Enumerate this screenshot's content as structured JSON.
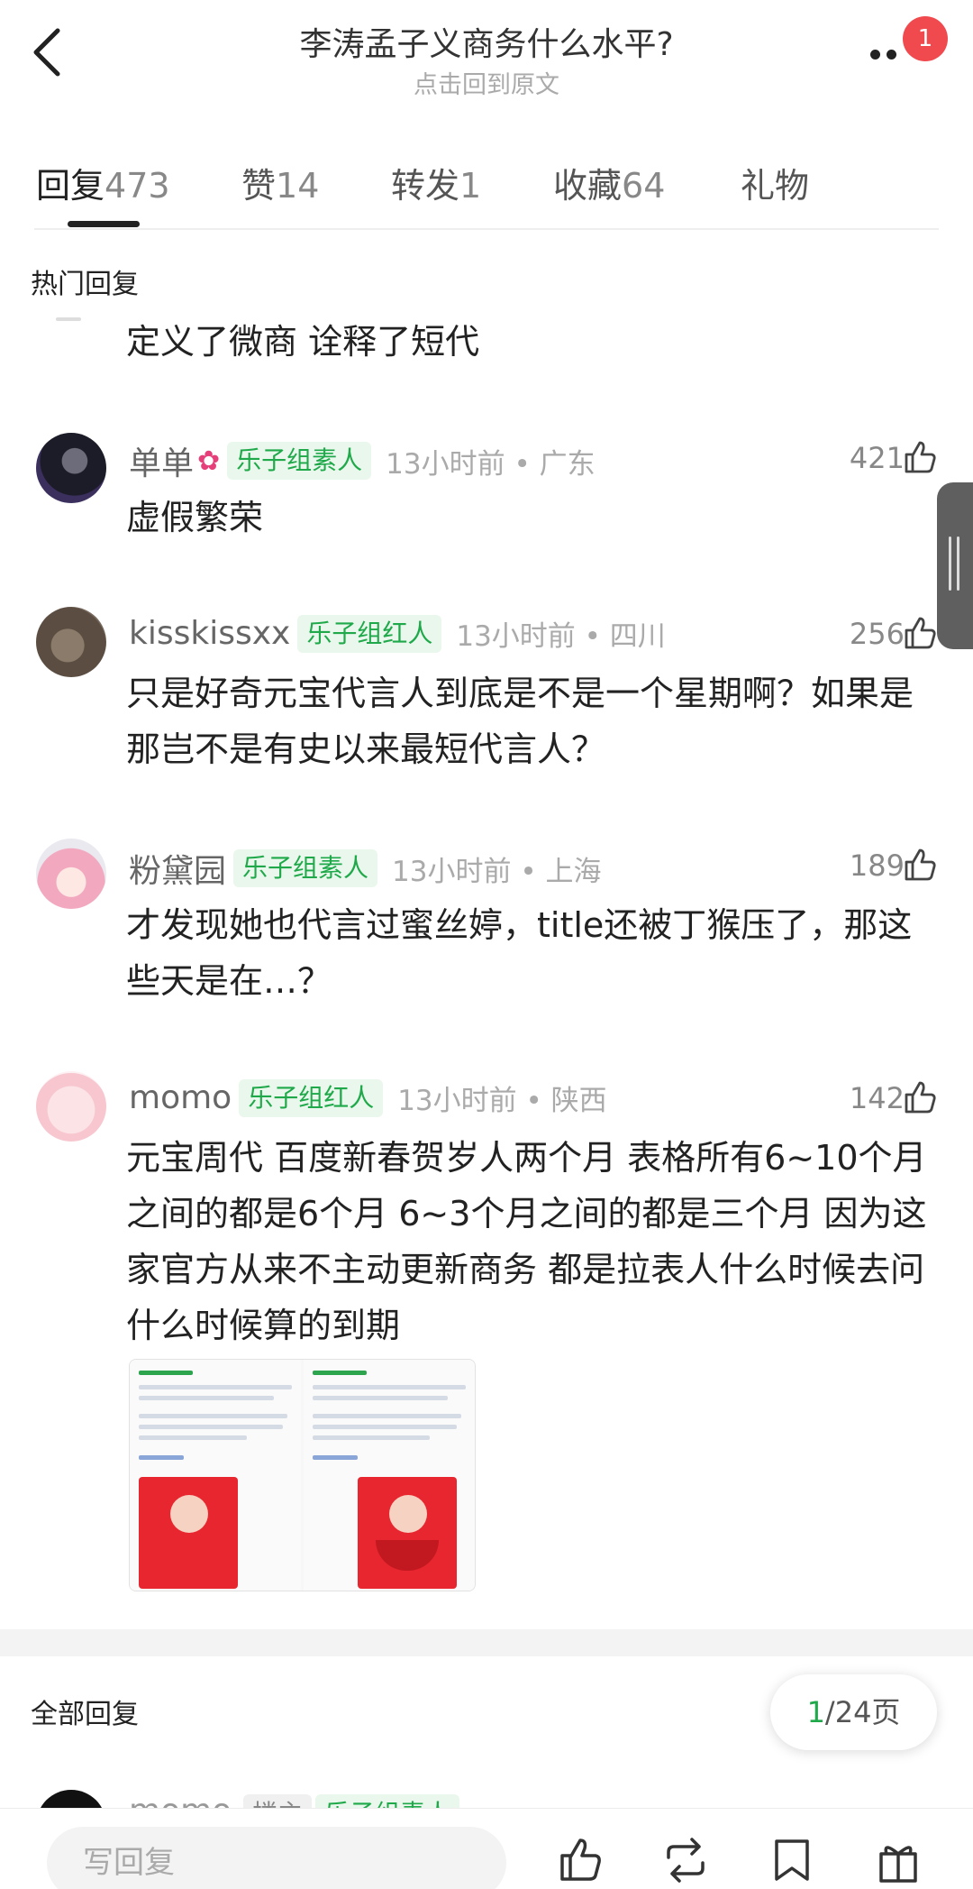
{
  "header": {
    "title": "李涛孟子义商务什么水平?",
    "subtitle": "点击回到原文",
    "notification_count": "1"
  },
  "tabs": [
    {
      "label": "回复",
      "count": "473",
      "active": true
    },
    {
      "label": "赞",
      "count": "14"
    },
    {
      "label": "转发",
      "count": "1"
    },
    {
      "label": "收藏",
      "count": "64"
    },
    {
      "label": "礼物",
      "count": ""
    }
  ],
  "hot_section_label": "热门回复",
  "cut_off_text": "定义了微商 诠释了短代",
  "comments": [
    {
      "name": "单单",
      "tag": "乐子组素人",
      "time_location": "13小时前 • 广东",
      "likes": "421",
      "text": "虚假繁荣"
    },
    {
      "name": "kisskissxx",
      "tag": "乐子组红人",
      "time_location": "13小时前 • 四川",
      "likes": "256",
      "text": "只是好奇元宝代言人到底是不是一个星期啊？如果是那岂不是有史以来最短代言人？"
    },
    {
      "name": "粉黛园",
      "tag": "乐子组素人",
      "time_location": "13小时前 • 上海",
      "likes": "189",
      "text": "才发现她也代言过蜜丝婷，title还被丁猴压了，那这些天是在…？"
    },
    {
      "name": "momo",
      "tag": "乐子组红人",
      "time_location": "13小时前 • 陕西",
      "likes": "142",
      "text": "元宝周代 百度新春贺岁人两个月 表格所有6~10个月之间的都是6个月  6~3个月之间的都是三个月 因为这家官方从来不主动更新商务 都是拉表人什么时候去问什么时候算的到期"
    }
  ],
  "all_section_label": "全部回复",
  "pager": {
    "current": "1",
    "total": "/24页"
  },
  "partial_comment": {
    "name": "momo",
    "tag_op": "楼主",
    "tag": "乐子组素人"
  },
  "bottom_bar": {
    "reply_placeholder": "写回复"
  },
  "colors": {
    "accent_green": "#1fa94a",
    "badge_red": "#f0494e"
  }
}
